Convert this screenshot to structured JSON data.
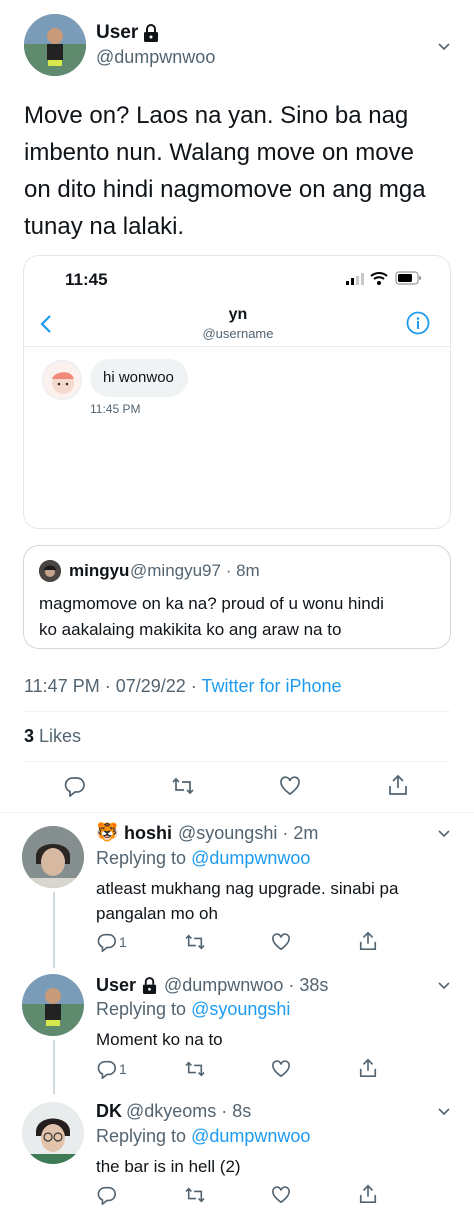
{
  "main_tweet": {
    "name": "User",
    "handle": "@dumpwnwoo",
    "text_lines": [
      "Move on? Laos na yan. Sino ba nag",
      "imbento nun. Walang move on move",
      "on dito hindi nagmomove on ang mga",
      "tunay na lalaki."
    ],
    "dm_screenshot": {
      "time": "11:45",
      "title": "yn",
      "subtitle": "@username",
      "message": "hi wonwoo",
      "message_time": "11:45 PM"
    },
    "quote": {
      "name": "mingyu",
      "handle_time": "@mingyu97 · 8m",
      "text_lines": [
        "magmomove on ka na? proud of u wonu hindi",
        "ko aakalaing makikita ko ang araw na to"
      ]
    },
    "timestamp": "11:47 PM · 07/29/22 · ",
    "source": "Twitter for iPhone",
    "likes_count": "3",
    "likes_label": " Likes"
  },
  "replies": [
    {
      "emoji": "🐯",
      "name": "hoshi",
      "handle_time": "@syoungshi · 2m",
      "replying_to_label": "Replying to ",
      "replying_to": "@dumpwnwoo",
      "text_lines": [
        "atleast mukhang nag upgrade. sinabi pa",
        "pangalan mo oh"
      ],
      "reply_count": "1"
    },
    {
      "name": "User",
      "handle_time": "@dumpwnwoo · 38s",
      "replying_to_label": "Replying to ",
      "replying_to": "@syoungshi",
      "text_lines": [
        "Moment ko na to"
      ],
      "reply_count": "1"
    },
    {
      "name": "DK",
      "handle_time": "@dkyeoms · 8s",
      "replying_to_label": "Replying to ",
      "replying_to": "@dumpwnwoo",
      "text_lines": [
        "the bar is in hell (2)"
      ],
      "reply_count": ""
    }
  ],
  "colors": {
    "accent": "#1d9bf0",
    "muted": "#536471",
    "text": "#0f1419",
    "like_icon": "#536471"
  }
}
